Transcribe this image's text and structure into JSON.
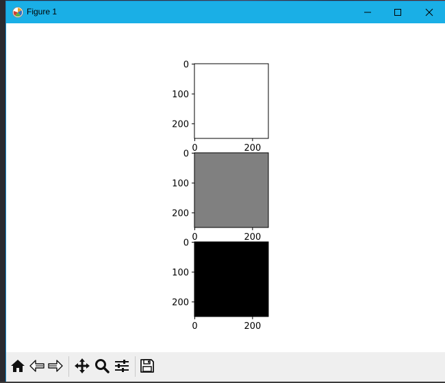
{
  "window": {
    "title": "Figure 1"
  },
  "icons": {
    "app": "matplotlib-icon",
    "minimize": "minimize-icon",
    "maximize": "maximize-icon",
    "close": "close-icon"
  },
  "toolbar": {
    "tools": [
      {
        "name": "home-icon",
        "label": "Home"
      },
      {
        "name": "back-icon",
        "label": "Back"
      },
      {
        "name": "forward-icon",
        "label": "Forward"
      },
      {
        "name": "pan-icon",
        "label": "Pan"
      },
      {
        "name": "zoom-icon",
        "label": "Zoom"
      },
      {
        "name": "configure-subplots-icon",
        "label": "Subplots"
      },
      {
        "name": "save-icon",
        "label": "Save"
      }
    ]
  },
  "chart_data": [
    {
      "type": "heatmap",
      "fill_color": "#ffffff",
      "x_ticks": [
        "0",
        "200"
      ],
      "y_ticks": [
        "0",
        "100",
        "200"
      ]
    },
    {
      "type": "heatmap",
      "fill_color": "#808080",
      "x_ticks": [
        "0",
        "200"
      ],
      "y_ticks": [
        "0",
        "100",
        "200"
      ]
    },
    {
      "type": "heatmap",
      "fill_color": "#000000",
      "x_ticks": [
        "0",
        "200"
      ],
      "y_ticks": [
        "0",
        "100",
        "200"
      ]
    }
  ]
}
